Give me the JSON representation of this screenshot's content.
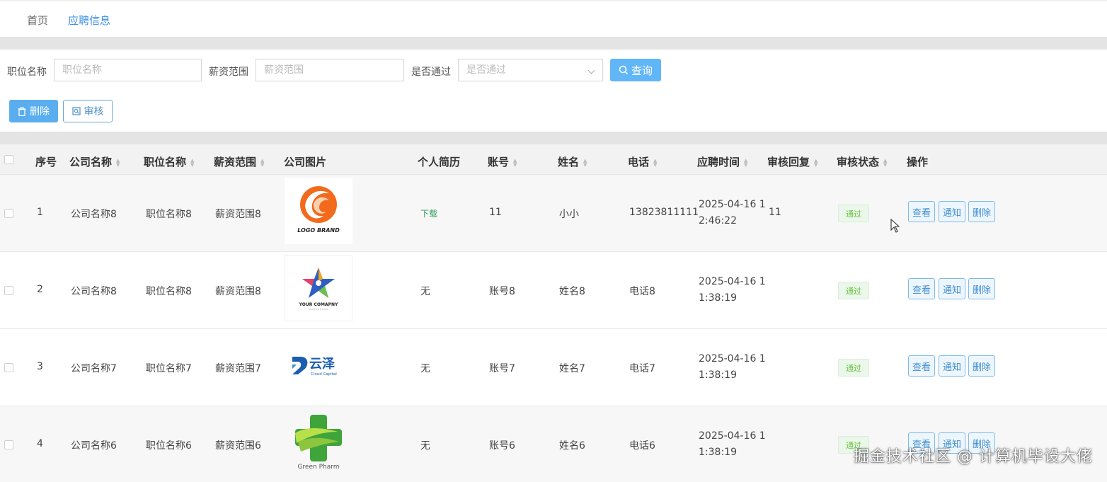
{
  "breadcrumb": {
    "home": "首页",
    "current": "应聘信息"
  },
  "search": {
    "job_label": "职位名称",
    "job_placeholder": "职位名称",
    "salary_label": "薪资范围",
    "salary_placeholder": "薪资范围",
    "pass_label": "是否通过",
    "pass_placeholder": "是否通过",
    "query_button": "查询"
  },
  "actions": {
    "delete_button": "删除",
    "audit_button": "审核"
  },
  "table": {
    "headers": {
      "index": "序号",
      "company": "公司名称",
      "job": "职位名称",
      "salary": "薪资范围",
      "image": "公司图片",
      "resume": "个人简历",
      "account": "账号",
      "name": "姓名",
      "phone": "电话",
      "time": "应聘时间",
      "reply": "审核回复",
      "status": "审核状态",
      "ops": "操作"
    },
    "rows": [
      {
        "index": "1",
        "company": "公司名称8",
        "job": "职位名称8",
        "salary": "薪资范围8",
        "logo_text": "LOGO BRAND",
        "resume": "下载",
        "account": "11",
        "name": "小小",
        "phone": "13823811111",
        "time_line1": "2025-04-16 1",
        "time_line2": "2:46:22",
        "reply": "11",
        "status": "通过"
      },
      {
        "index": "2",
        "company": "公司名称8",
        "job": "职位名称8",
        "salary": "薪资范围8",
        "logo_text": "YOUR COMAPNY",
        "resume": "无",
        "account": "账号8",
        "name": "姓名8",
        "phone": "电话8",
        "time_line1": "2025-04-16 1",
        "time_line2": "1:38:19",
        "reply": "",
        "status": "通过"
      },
      {
        "index": "3",
        "company": "公司名称7",
        "job": "职位名称7",
        "salary": "薪资范围7",
        "logo_text": "云泽",
        "logo_sub": "Cloud Capital",
        "resume": "无",
        "account": "账号7",
        "name": "姓名7",
        "phone": "电话7",
        "time_line1": "2025-04-16 1",
        "time_line2": "1:38:19",
        "reply": "",
        "status": "通过"
      },
      {
        "index": "4",
        "company": "公司名称6",
        "job": "职位名称6",
        "salary": "薪资范围6",
        "logo_text": "Green Pharm",
        "resume": "无",
        "account": "账号6",
        "name": "姓名6",
        "phone": "电话6",
        "time_line1": "2025-04-16 1",
        "time_line2": "1:38:19",
        "reply": "",
        "status": "通过"
      }
    ],
    "row_ops": {
      "view": "查看",
      "notify": "通知",
      "delete": "删除"
    }
  },
  "watermark": "掘金技术社区 @ 计算机毕设大佬",
  "colors": {
    "primary": "#5aaef0",
    "link": "#3a8ee6",
    "success": "#67c23a"
  }
}
